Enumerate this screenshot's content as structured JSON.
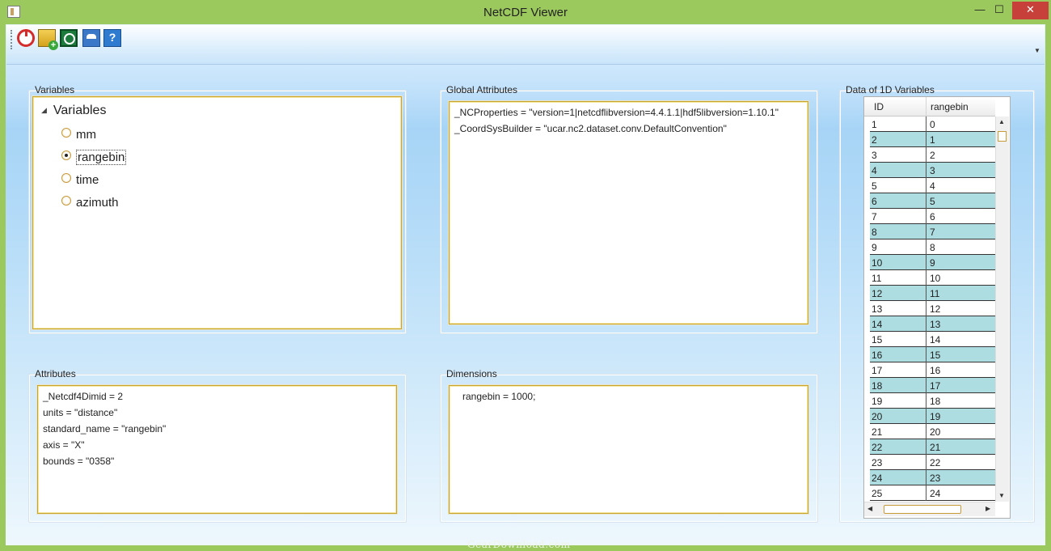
{
  "window": {
    "title": "NetCDF Viewer",
    "minimize_glyph": "—",
    "maximize_glyph": "☐",
    "close_glyph": "✕"
  },
  "toolbar": {
    "icons": [
      "power-icon",
      "open-file-icon",
      "reload-icon",
      "users-icon",
      "help-icon"
    ],
    "help_glyph": "?"
  },
  "variables": {
    "label": "Variables",
    "root": "Variables",
    "items": [
      "mm",
      "rangebin",
      "time",
      "azimuth"
    ],
    "selected": "rangebin"
  },
  "global_attributes": {
    "label": "Global Attributes",
    "lines": [
      "_NCProperties = \"version=1|netcdflibversion=4.4.1.1|hdf5libversion=1.10.1\"",
      "_CoordSysBuilder = \"ucar.nc2.dataset.conv.DefaultConvention\""
    ]
  },
  "attributes": {
    "label": "Attributes",
    "lines": [
      "_Netcdf4Dimid = 2",
      "units = \"distance\"",
      "standard_name = \"rangebin\"",
      "axis = \"X\"",
      "bounds = \"0358\""
    ]
  },
  "dimensions": {
    "label": "Dimensions",
    "lines": [
      "rangebin = 1000;"
    ]
  },
  "data_1d": {
    "label": "Data of 1D Variables",
    "columns": [
      "ID",
      "rangebin"
    ],
    "rows": [
      [
        "1",
        "0"
      ],
      [
        "2",
        "1"
      ],
      [
        "3",
        "2"
      ],
      [
        "4",
        "3"
      ],
      [
        "5",
        "4"
      ],
      [
        "6",
        "5"
      ],
      [
        "7",
        "6"
      ],
      [
        "8",
        "7"
      ],
      [
        "9",
        "8"
      ],
      [
        "10",
        "9"
      ],
      [
        "11",
        "10"
      ],
      [
        "12",
        "11"
      ],
      [
        "13",
        "12"
      ],
      [
        "14",
        "13"
      ],
      [
        "15",
        "14"
      ],
      [
        "16",
        "15"
      ],
      [
        "17",
        "16"
      ],
      [
        "18",
        "17"
      ],
      [
        "19",
        "18"
      ],
      [
        "20",
        "19"
      ],
      [
        "21",
        "20"
      ],
      [
        "22",
        "21"
      ],
      [
        "23",
        "22"
      ],
      [
        "24",
        "23"
      ],
      [
        "25",
        "24"
      ]
    ]
  },
  "watermark": "GearDownload.com",
  "colors": {
    "frame": "#9cc95e",
    "alt_row": "#aedde1",
    "close": "#c7413a",
    "focus_border": "#c8a52a"
  }
}
